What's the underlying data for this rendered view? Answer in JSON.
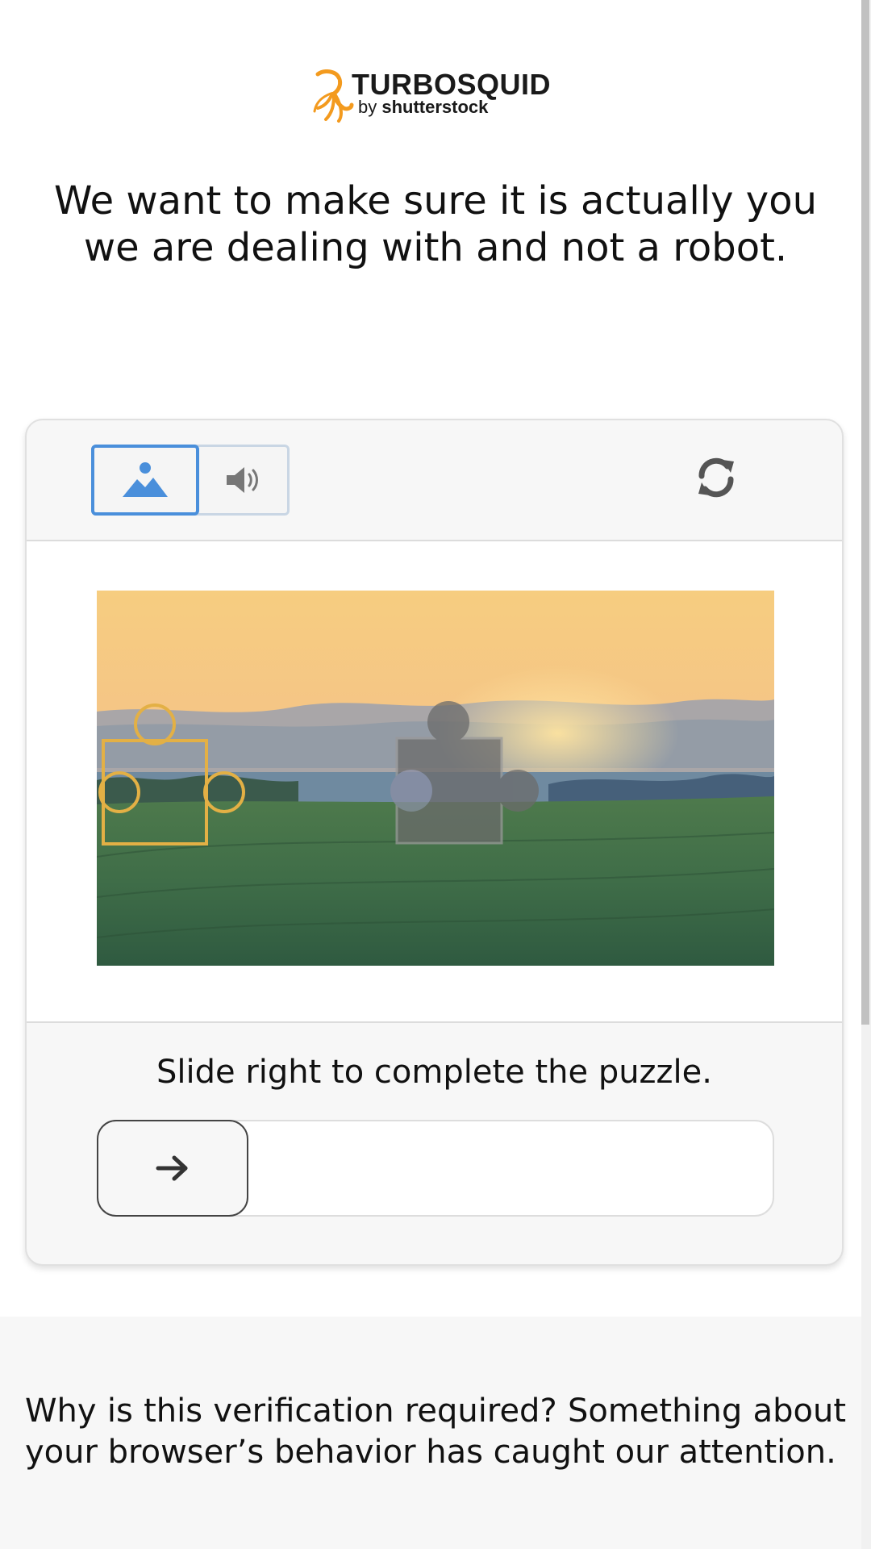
{
  "logo": {
    "line1": "TURBOSQUID",
    "line2_prefix": "by ",
    "line2_brand": "shutterstock",
    "accent_color": "#f39a1e"
  },
  "headline": "We want to make sure it is actually you we are dealing with and not a robot.",
  "challenge": {
    "modes": [
      {
        "name": "image",
        "icon": "image-icon",
        "selected": true
      },
      {
        "name": "audio",
        "icon": "speaker-icon",
        "selected": false
      }
    ],
    "refresh_icon": "refresh-icon",
    "instruction": "Slide right to complete the puzzle.",
    "slider_icon": "arrow-right-icon",
    "slider_progress": 0,
    "selected_color": "#4a8fdb"
  },
  "info": {
    "text": "Why is this verification required? Something about your browser’s behavior has caught our attention."
  }
}
